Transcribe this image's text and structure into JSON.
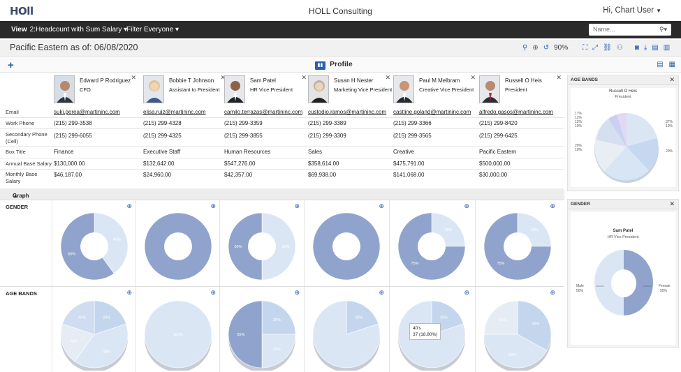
{
  "app": {
    "logo": "HOll",
    "title": "HOLL Consulting",
    "user_greeting": "Hi, Chart User"
  },
  "toolbar": {
    "view_label": "View",
    "view_value": "2:Headcount with Sum Salary",
    "filter_label": "Filter",
    "filter_value": "Everyone",
    "search_placeholder": "Name..."
  },
  "subheader": {
    "title": "Pacific Eastern as of: 06/08/2020",
    "zoom": "90%"
  },
  "profile": {
    "title": "Profile",
    "row_labels": [
      "Email",
      "Work Phone",
      "Secondary Phone (Cell)",
      "Box Title",
      "Annual Base Salary",
      "Monthly Base Salary"
    ],
    "people": [
      {
        "name": "Edward P Rodriguez",
        "role": "CFO",
        "email": "suki.perea@martininc.com",
        "work_phone": "(215) 299-3538",
        "cell": "(215) 299-6055",
        "box_title": "Finance",
        "annual": "$130,000.00",
        "monthly": "$46,187.00"
      },
      {
        "name": "Bobbie T Johnson",
        "role": "Assistant to President",
        "email": "elisa.ruiz@martininc.com",
        "work_phone": "(215) 299-4328",
        "cell": "(215) 299-4325",
        "box_title": "Executive Staff",
        "annual": "$132,642.00",
        "monthly": "$24,960.00"
      },
      {
        "name": "Sam Patel",
        "role": "HR Vice President",
        "email": "camilo.terrazas@martininc.com",
        "work_phone": "(215) 299-3359",
        "cell": "(215) 299-3855",
        "box_title": "Human Resources",
        "annual": "$547,276.00",
        "monthly": "$42,357.00"
      },
      {
        "name": "Susan H Nester",
        "role": "Marketing Vice President",
        "email": "custodio.ramos@martininc.com",
        "work_phone": "(215) 299-3389",
        "cell": "(215) 299-3309",
        "box_title": "Sales",
        "annual": "$358,614.00",
        "monthly": "$69,938.00"
      },
      {
        "name": "Paul M Melbram",
        "role": "Creative Vice President",
        "email": "castline.goland@martininc.com",
        "work_phone": "(215) 299-3366",
        "cell": "(215) 299-3565",
        "box_title": "Creative",
        "annual": "$475,791.00",
        "monthly": "$141,068.00"
      },
      {
        "name": "Russell O Heis",
        "role": "President",
        "email": "alfredo.gasos@martininc.com",
        "work_phone": "(215) 299-8420",
        "cell": "(215) 299-6425",
        "box_title": "Pacific Eastern",
        "annual": "$500,000.00",
        "monthly": "$30,000.00"
      }
    ]
  },
  "graph": {
    "section_label": "Graph",
    "gender_label": "GENDER",
    "age_label": "AGE BANDS",
    "gender_charts": [
      {
        "labels": [
          "40%",
          "60%"
        ],
        "values": [
          40,
          60
        ]
      },
      {
        "labels": [],
        "values": [
          100
        ]
      },
      {
        "labels": [
          "50%",
          "50%"
        ],
        "values": [
          50,
          50
        ]
      },
      {
        "labels": [],
        "values": [
          100
        ]
      },
      {
        "labels": [
          "25%",
          "75%"
        ],
        "values": [
          25,
          75
        ]
      },
      {
        "labels": [
          "25%",
          "75%"
        ],
        "values": [
          25,
          75
        ]
      }
    ],
    "age_charts": [
      {
        "labels": [
          "20%",
          "40%",
          "40%",
          "40%"
        ],
        "values": [
          20,
          40,
          20,
          20
        ]
      },
      {
        "labels": [
          "100%"
        ],
        "values": [
          100
        ]
      },
      {
        "labels": [
          "25%",
          "25%",
          "55%"
        ],
        "values": [
          25,
          25,
          50
        ]
      },
      {
        "labels": [
          "20%"
        ],
        "values": [
          20,
          80
        ]
      },
      {
        "labels": [
          "20%"
        ],
        "values": [
          20,
          80
        ]
      },
      {
        "labels": [
          "33%",
          "25%",
          "25%"
        ],
        "values": [
          33,
          42,
          25
        ]
      }
    ],
    "tooltip_title": "40's",
    "tooltip_value": "37 (18.80%)"
  },
  "side_age": {
    "header": "AGE BANDS",
    "name": "Russell O Heis",
    "role": "President",
    "labels_left": [
      "17%",
      "12%",
      "12%",
      "10%",
      "20%",
      "10%"
    ],
    "labels_right": [
      "37%",
      "10%",
      "20%"
    ]
  },
  "side_gender": {
    "header": "GENDER",
    "name": "Sam Patel",
    "role": "HR Vice President",
    "left_label": "Male",
    "left_value": "50%",
    "right_label": "Female",
    "right_value": "50%"
  },
  "colors": {
    "accent": "#2a5fb0",
    "dark_bar": "#2a2a2a",
    "pie_dark": "#8fa3cc",
    "pie_light": "#dbe6f5",
    "pie_mid": "#c3d6ee"
  }
}
